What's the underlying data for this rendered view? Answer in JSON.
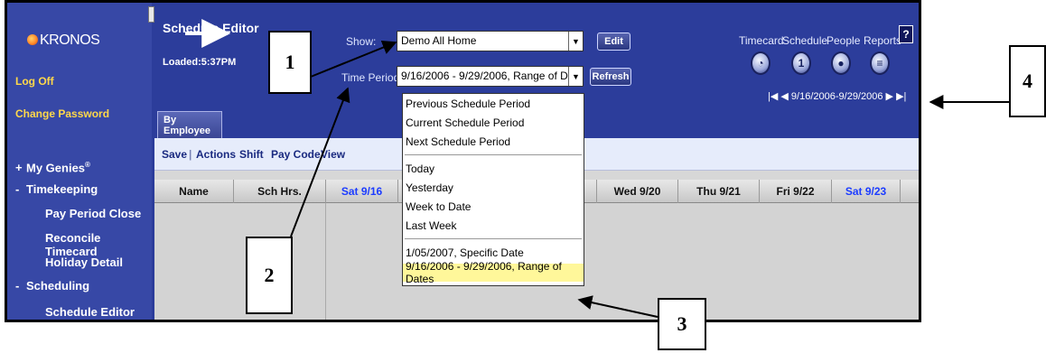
{
  "sidebar": {
    "logo": "KRONOS",
    "links": [
      "Log Off",
      "Change Password"
    ],
    "sections": [
      {
        "prefix": "+",
        "label": "My Genies",
        "mark": "®"
      },
      {
        "prefix": "-",
        "label": "Timekeeping"
      },
      {
        "prefix": "-",
        "label": "Scheduling"
      }
    ],
    "timekeeping_items": [
      "Pay Period Close",
      "Reconcile Timecard",
      "Holiday Detail"
    ],
    "scheduling_items": [
      "Schedule Editor"
    ]
  },
  "header": {
    "title": "Schedule Editor",
    "loaded": "Loaded:5:37PM",
    "show_label": "Show:",
    "show_value": "Demo All Home",
    "time_period_label": "Time Period:",
    "time_period_value": "9/16/2006 - 9/29/2006, Range of Dates",
    "edit_button": "Edit",
    "refresh_button": "Refresh"
  },
  "topnav": {
    "items": [
      "Timecard",
      "Schedule",
      "People",
      "Reports"
    ],
    "help": "?",
    "date_range": "9/16/2006-9/29/2006"
  },
  "tabs": [
    "By Employee"
  ],
  "toolbar": {
    "items": [
      "Save",
      "Actions",
      "Shift",
      "Pay Code",
      "View"
    ],
    "separator": "|"
  },
  "grid": {
    "columns": [
      "Name",
      "Sch Hrs.",
      "Sat 9/16",
      "Su",
      "Wed 9/20",
      "Thu 9/21",
      "Fri 9/22",
      "Sat 9/23"
    ]
  },
  "dropdown": {
    "groups": [
      [
        "Previous Schedule Period",
        "Current Schedule Period",
        "Next Schedule Period"
      ],
      [
        "Today",
        "Yesterday",
        "Week to Date",
        "Last Week"
      ],
      [
        "1/05/2007, Specific Date",
        "9/16/2006 - 9/29/2006, Range of Dates"
      ]
    ],
    "selected": "9/16/2006 - 9/29/2006, Range of Dates"
  },
  "callouts": [
    "1",
    "2",
    "3",
    "4"
  ],
  "colors": {
    "frame_bg": "#2c3d9b",
    "sidebar_bg": "#3748a6",
    "link": "#ffd84a",
    "saturday": "#1c3cff",
    "selected_item": "#fff79a"
  }
}
